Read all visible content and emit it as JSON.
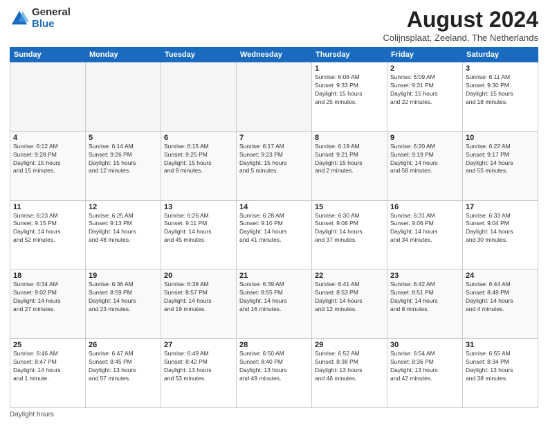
{
  "logo": {
    "general": "General",
    "blue": "Blue"
  },
  "title": "August 2024",
  "location": "Colijnsplaat, Zeeland, The Netherlands",
  "weekdays": [
    "Sunday",
    "Monday",
    "Tuesday",
    "Wednesday",
    "Thursday",
    "Friday",
    "Saturday"
  ],
  "footer_label": "Daylight hours",
  "weeks": [
    [
      {
        "day": "",
        "info": ""
      },
      {
        "day": "",
        "info": ""
      },
      {
        "day": "",
        "info": ""
      },
      {
        "day": "",
        "info": ""
      },
      {
        "day": "1",
        "info": "Sunrise: 6:08 AM\nSunset: 9:33 PM\nDaylight: 15 hours\nand 25 minutes."
      },
      {
        "day": "2",
        "info": "Sunrise: 6:09 AM\nSunset: 9:31 PM\nDaylight: 15 hours\nand 22 minutes."
      },
      {
        "day": "3",
        "info": "Sunrise: 6:11 AM\nSunset: 9:30 PM\nDaylight: 15 hours\nand 18 minutes."
      }
    ],
    [
      {
        "day": "4",
        "info": "Sunrise: 6:12 AM\nSunset: 9:28 PM\nDaylight: 15 hours\nand 15 minutes."
      },
      {
        "day": "5",
        "info": "Sunrise: 6:14 AM\nSunset: 9:26 PM\nDaylight: 15 hours\nand 12 minutes."
      },
      {
        "day": "6",
        "info": "Sunrise: 6:15 AM\nSunset: 9:25 PM\nDaylight: 15 hours\nand 9 minutes."
      },
      {
        "day": "7",
        "info": "Sunrise: 6:17 AM\nSunset: 9:23 PM\nDaylight: 15 hours\nand 5 minutes."
      },
      {
        "day": "8",
        "info": "Sunrise: 6:19 AM\nSunset: 9:21 PM\nDaylight: 15 hours\nand 2 minutes."
      },
      {
        "day": "9",
        "info": "Sunrise: 6:20 AM\nSunset: 9:19 PM\nDaylight: 14 hours\nand 58 minutes."
      },
      {
        "day": "10",
        "info": "Sunrise: 6:22 AM\nSunset: 9:17 PM\nDaylight: 14 hours\nand 55 minutes."
      }
    ],
    [
      {
        "day": "11",
        "info": "Sunrise: 6:23 AM\nSunset: 9:15 PM\nDaylight: 14 hours\nand 52 minutes."
      },
      {
        "day": "12",
        "info": "Sunrise: 6:25 AM\nSunset: 9:13 PM\nDaylight: 14 hours\nand 48 minutes."
      },
      {
        "day": "13",
        "info": "Sunrise: 6:26 AM\nSunset: 9:11 PM\nDaylight: 14 hours\nand 45 minutes."
      },
      {
        "day": "14",
        "info": "Sunrise: 6:28 AM\nSunset: 9:10 PM\nDaylight: 14 hours\nand 41 minutes."
      },
      {
        "day": "15",
        "info": "Sunrise: 6:30 AM\nSunset: 9:08 PM\nDaylight: 14 hours\nand 37 minutes."
      },
      {
        "day": "16",
        "info": "Sunrise: 6:31 AM\nSunset: 9:06 PM\nDaylight: 14 hours\nand 34 minutes."
      },
      {
        "day": "17",
        "info": "Sunrise: 6:33 AM\nSunset: 9:04 PM\nDaylight: 14 hours\nand 30 minutes."
      }
    ],
    [
      {
        "day": "18",
        "info": "Sunrise: 6:34 AM\nSunset: 9:02 PM\nDaylight: 14 hours\nand 27 minutes."
      },
      {
        "day": "19",
        "info": "Sunrise: 6:36 AM\nSunset: 8:59 PM\nDaylight: 14 hours\nand 23 minutes."
      },
      {
        "day": "20",
        "info": "Sunrise: 6:38 AM\nSunset: 8:57 PM\nDaylight: 14 hours\nand 19 minutes."
      },
      {
        "day": "21",
        "info": "Sunrise: 6:39 AM\nSunset: 8:55 PM\nDaylight: 14 hours\nand 16 minutes."
      },
      {
        "day": "22",
        "info": "Sunrise: 6:41 AM\nSunset: 8:53 PM\nDaylight: 14 hours\nand 12 minutes."
      },
      {
        "day": "23",
        "info": "Sunrise: 6:42 AM\nSunset: 8:51 PM\nDaylight: 14 hours\nand 8 minutes."
      },
      {
        "day": "24",
        "info": "Sunrise: 6:44 AM\nSunset: 8:49 PM\nDaylight: 14 hours\nand 4 minutes."
      }
    ],
    [
      {
        "day": "25",
        "info": "Sunrise: 6:46 AM\nSunset: 8:47 PM\nDaylight: 14 hours\nand 1 minute."
      },
      {
        "day": "26",
        "info": "Sunrise: 6:47 AM\nSunset: 8:45 PM\nDaylight: 13 hours\nand 57 minutes."
      },
      {
        "day": "27",
        "info": "Sunrise: 6:49 AM\nSunset: 8:42 PM\nDaylight: 13 hours\nand 53 minutes."
      },
      {
        "day": "28",
        "info": "Sunrise: 6:50 AM\nSunset: 8:40 PM\nDaylight: 13 hours\nand 49 minutes."
      },
      {
        "day": "29",
        "info": "Sunrise: 6:52 AM\nSunset: 8:38 PM\nDaylight: 13 hours\nand 46 minutes."
      },
      {
        "day": "30",
        "info": "Sunrise: 6:54 AM\nSunset: 8:36 PM\nDaylight: 13 hours\nand 42 minutes."
      },
      {
        "day": "31",
        "info": "Sunrise: 6:55 AM\nSunset: 8:34 PM\nDaylight: 13 hours\nand 38 minutes."
      }
    ]
  ]
}
